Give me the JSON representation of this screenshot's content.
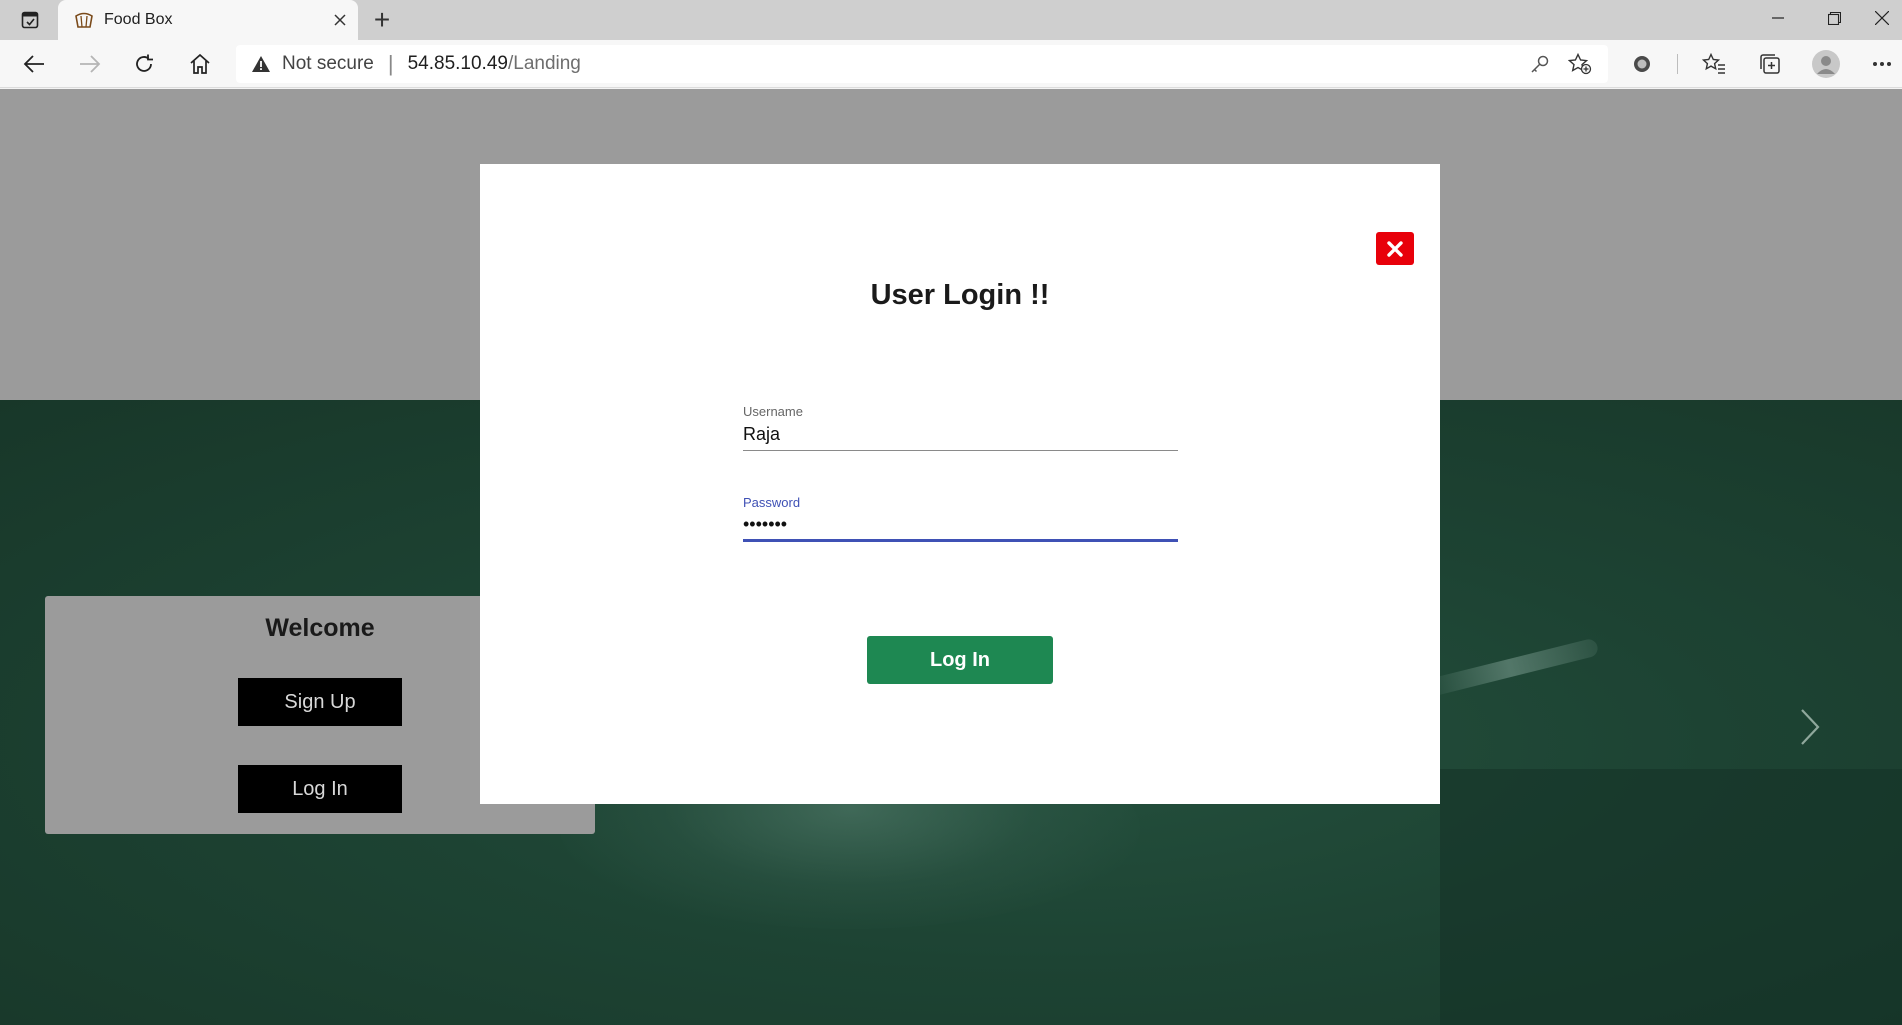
{
  "browser": {
    "tab_title": "Food Box",
    "new_tab_symbol": "+",
    "address": {
      "security_label": "Not secure",
      "host": "54.85.10.49",
      "path": "/Landing"
    }
  },
  "page": {
    "welcome": {
      "title": "Welcome",
      "signup_label": "Sign Up",
      "login_label": "Log In"
    },
    "modal": {
      "title": "User Login !!",
      "username": {
        "label": "Username",
        "value": "Raja"
      },
      "password": {
        "label": "Password",
        "value": "raja123"
      },
      "submit_label": "Log In"
    }
  },
  "colors": {
    "close_button": "#e8000a",
    "login_button": "#1e8852",
    "focus_accent": "#3f51b5",
    "hero_green": "#1d4333"
  }
}
